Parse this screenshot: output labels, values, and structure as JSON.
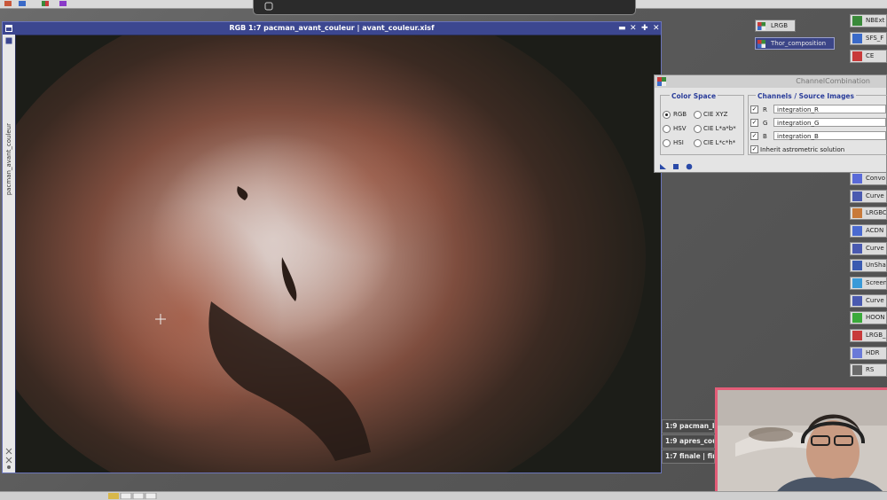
{
  "image_window": {
    "title": "RGB 1:7 pacman_avant_couleur | avant_couleur.xisf",
    "side_label": "pacman_avant_couleur",
    "controls": [
      "▬",
      "✕",
      "✚",
      "✕"
    ]
  },
  "chips": [
    {
      "label": "LRGB"
    },
    {
      "label": "Thor_composition"
    }
  ],
  "channel_combination": {
    "title": "ChannelCombination",
    "color_space_title": "Color Space",
    "color_spaces": [
      {
        "label": "RGB",
        "selected": true
      },
      {
        "label": "CIE XYZ",
        "selected": false
      },
      {
        "label": "HSV",
        "selected": false
      },
      {
        "label": "CIE L*a*b*",
        "selected": false
      },
      {
        "label": "HSI",
        "selected": false
      },
      {
        "label": "CIE L*c*h*",
        "selected": false
      }
    ],
    "channels_title": "Channels / Source Images",
    "channels": [
      {
        "channel": "R",
        "checked": true,
        "image": "integration_R"
      },
      {
        "channel": "G",
        "checked": true,
        "image": "integration_G"
      },
      {
        "channel": "B",
        "checked": true,
        "image": "integration_B"
      }
    ],
    "inherit_label": "Inherit astrometric solution",
    "inherit_checked": true
  },
  "right_icons": [
    {
      "label": "NBExt",
      "color": "#3a8a3a"
    },
    {
      "label": "SFS_F",
      "color": "#3a6ac8"
    },
    {
      "label": "CE",
      "color": "#c83a3a"
    },
    {
      "label": "Convo",
      "color": "#5a6ad8"
    },
    {
      "label": "Curve",
      "color": "#4a5ab0"
    },
    {
      "label": "LRGBC",
      "color": "#c87a3a"
    },
    {
      "label": "ACDN",
      "color": "#4a6ad0"
    },
    {
      "label": "Curve",
      "color": "#4a5ab0"
    },
    {
      "label": "UnSha",
      "color": "#3a5ab0"
    },
    {
      "label": "Screen",
      "color": "#3a9ad8"
    },
    {
      "label": "Curve",
      "color": "#4a5ab0"
    },
    {
      "label": "HOON",
      "color": "#3aaa3a"
    },
    {
      "label": "LRGB_",
      "color": "#c83a3a"
    },
    {
      "label": "HDR",
      "color": "#6a7ad8"
    },
    {
      "label": "RS",
      "color": "#6a6a6a"
    }
  ],
  "mini_windows": [
    {
      "label": "1:9 pacman_b"
    },
    {
      "label": "1:9 apres_cou"
    },
    {
      "label": "1:7 finale | fin"
    }
  ]
}
